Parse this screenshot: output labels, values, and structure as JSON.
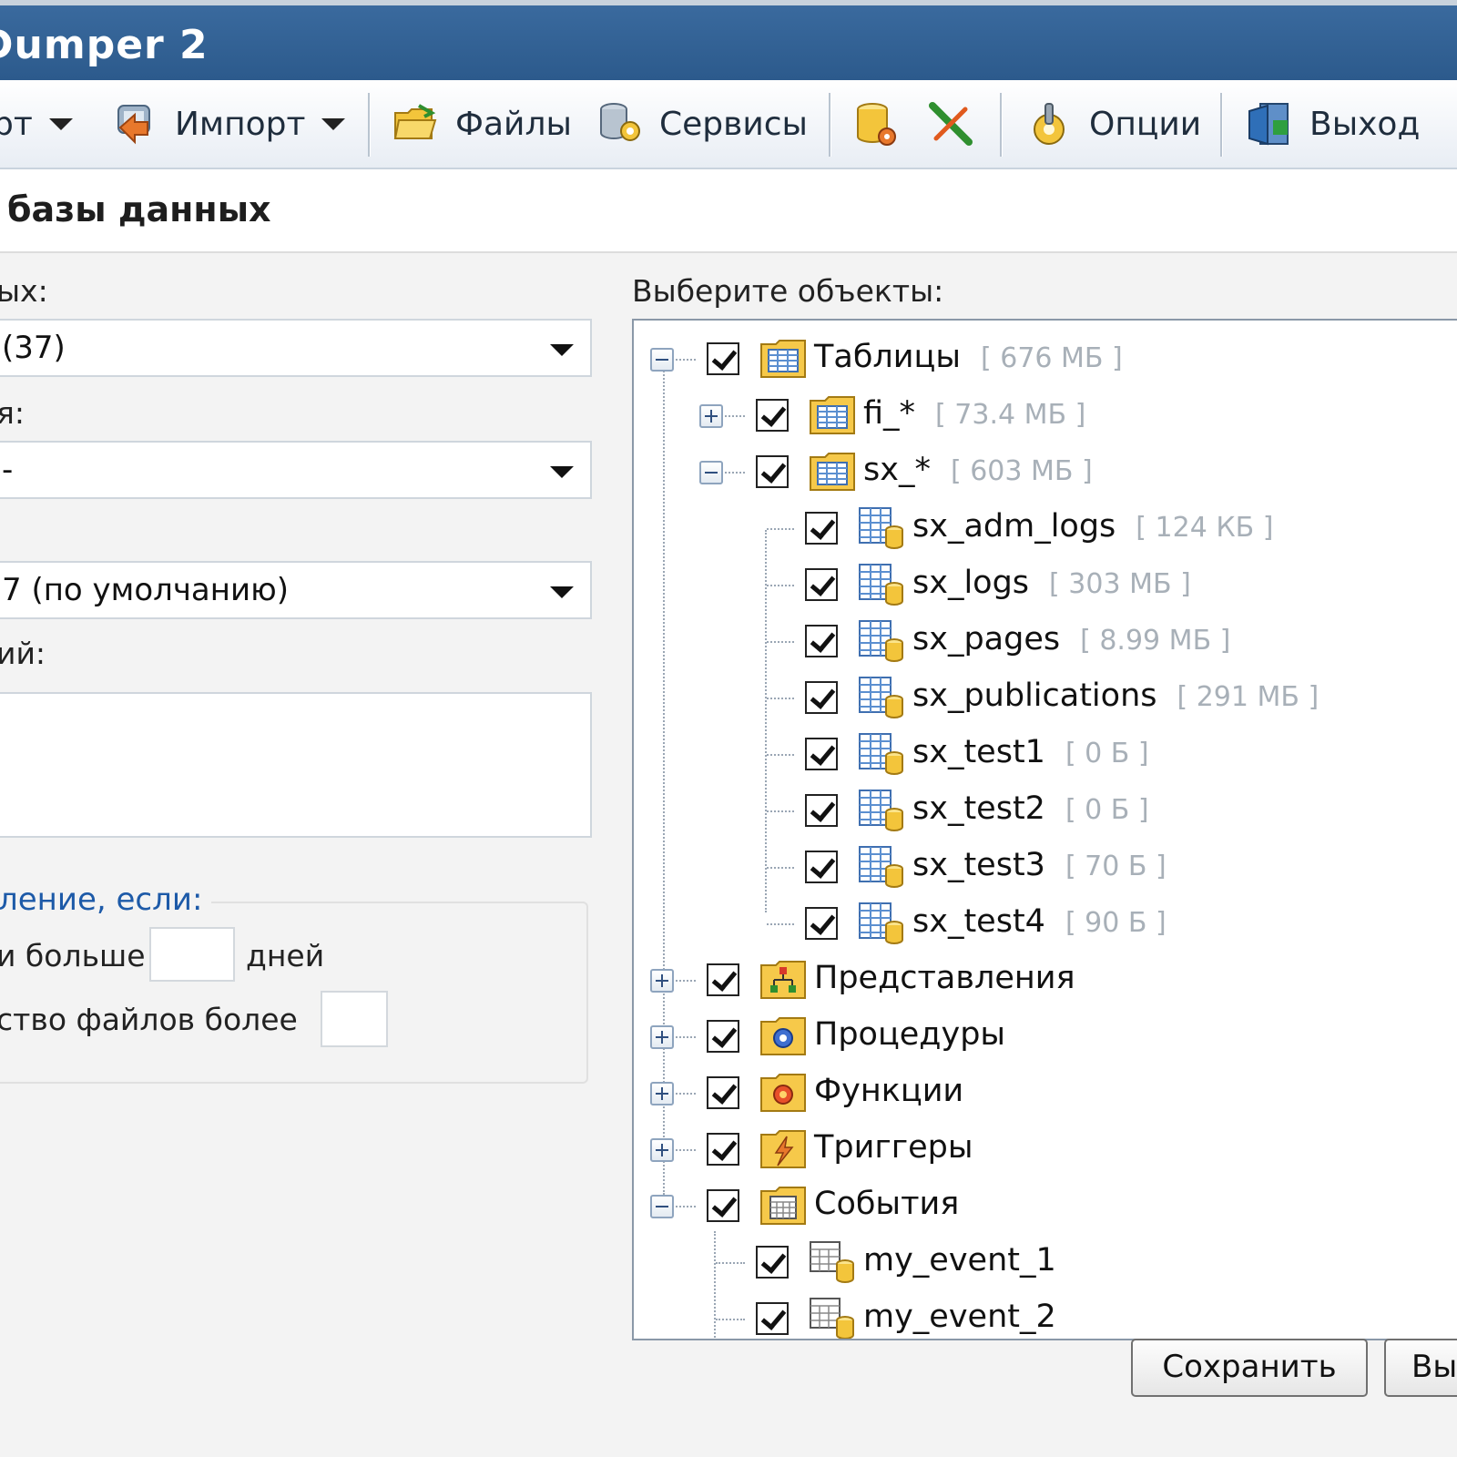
{
  "window": {
    "title": "Dumper 2"
  },
  "toolbar": {
    "items": [
      {
        "label": "рт",
        "icon": "export-icon"
      },
      {
        "label": "Импорт",
        "icon": "import-icon"
      },
      {
        "label": "Файлы",
        "icon": "folder-icon"
      },
      {
        "label": "Сервисы",
        "icon": "services-icon"
      },
      {
        "label": "",
        "icon": "database-settings-icon"
      },
      {
        "label": "",
        "icon": "disconnect-icon"
      },
      {
        "label": "Опции",
        "icon": "options-icon"
      },
      {
        "label": "Выход",
        "icon": "exit-icon"
      }
    ]
  },
  "section": {
    "title": "базы данных"
  },
  "form": {
    "db_label": "ых:",
    "db_value": "(37)",
    "charset_label": "я:",
    "charset_value": "-",
    "compression_value": "7 (по умолчанию)",
    "comment_label": "ий:",
    "comment_value": "",
    "autodelete": {
      "legend": "ление, если:",
      "age_prefix": "и больше",
      "age_value": "",
      "age_suffix": "дней",
      "count_prefix": "ство файлов более",
      "count_value": ""
    }
  },
  "tree": {
    "label": "Выберите объекты:",
    "nodes": [
      {
        "name": "Таблицы",
        "size": "[ 676 МБ ]"
      },
      {
        "name": "fi_*",
        "size": "[ 73.4 МБ ]"
      },
      {
        "name": "sx_*",
        "size": "[ 603 МБ ]"
      },
      {
        "name": "sx_adm_logs",
        "size": "[ 124 КБ ]"
      },
      {
        "name": "sx_logs",
        "size": "[ 303 МБ ]"
      },
      {
        "name": "sx_pages",
        "size": "[ 8.99 МБ ]"
      },
      {
        "name": "sx_publications",
        "size": "[ 291 МБ ]"
      },
      {
        "name": "sx_test1",
        "size": "[ 0 Б ]"
      },
      {
        "name": "sx_test2",
        "size": "[ 0 Б ]"
      },
      {
        "name": "sx_test3",
        "size": "[ 70 Б ]"
      },
      {
        "name": "sx_test4",
        "size": "[ 90 Б ]"
      },
      {
        "name": "Представления",
        "size": ""
      },
      {
        "name": "Процедуры",
        "size": ""
      },
      {
        "name": "Функции",
        "size": ""
      },
      {
        "name": "Триггеры",
        "size": ""
      },
      {
        "name": "События",
        "size": ""
      },
      {
        "name": "my_event_1",
        "size": ""
      },
      {
        "name": "my_event_2",
        "size": ""
      }
    ]
  },
  "buttons": {
    "save": "Сохранить",
    "cancel": "Вы"
  },
  "colors": {
    "titlebar": "#2c5a8c",
    "legend_text": "#1d5aa8",
    "size_text": "#a8b0b8"
  }
}
